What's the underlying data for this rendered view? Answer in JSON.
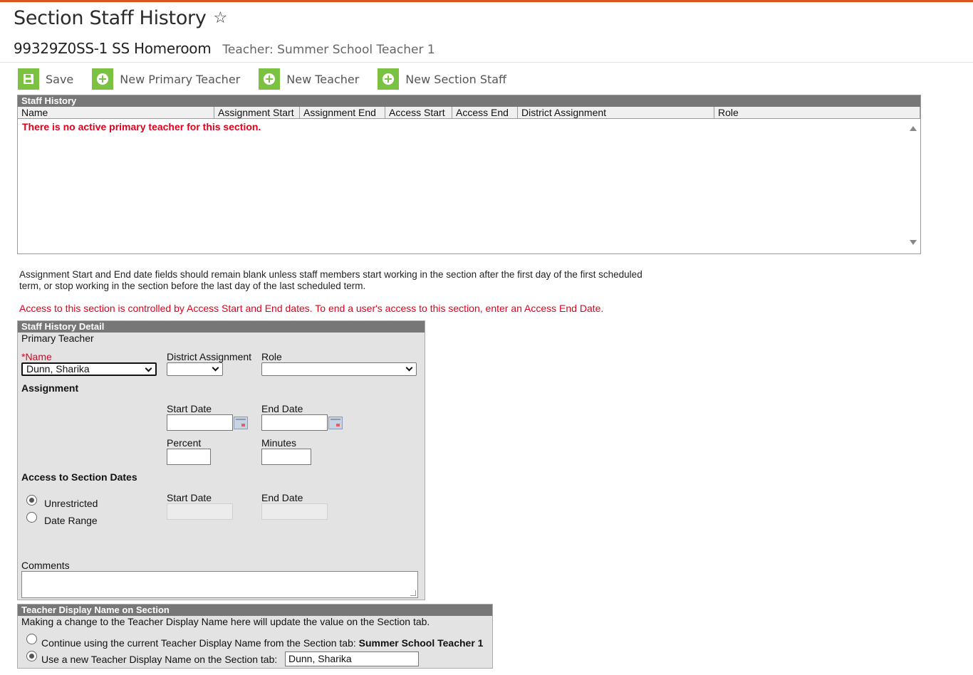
{
  "header": {
    "title": "Section Staff History",
    "favorite_icon": "star-outline-icon",
    "section_name": "99329Z0SS-1 SS Homeroom",
    "teacher_label": "Teacher: Summer School Teacher 1"
  },
  "toolbar": {
    "save_label": "Save",
    "new_primary_teacher_label": "New Primary Teacher",
    "new_teacher_label": "New Teacher",
    "new_section_staff_label": "New Section Staff",
    "accent_color": "#7cc242"
  },
  "history": {
    "title": "Staff History",
    "columns": [
      "Name",
      "Assignment Start",
      "Assignment End",
      "Access Start",
      "Access End",
      "District Assignment",
      "Role"
    ],
    "empty_message": "There is no active primary teacher for this section."
  },
  "notes": {
    "assignment_note": "Assignment Start and End date fields should remain blank unless staff members start working in the section after the first day of the first scheduled term, or stop working in the section before the last day of the last scheduled term.",
    "access_warning": "Access to this section is controlled by Access Start and End dates. To end a user's access to this section, enter an Access End Date."
  },
  "detail": {
    "title": "Staff History Detail",
    "subtitle": "Primary Teacher",
    "name_label": "*Name",
    "name_value": "Dunn, Sharika",
    "district_assignment_label": "District Assignment",
    "district_assignment_value": "",
    "role_label": "Role",
    "role_value": "",
    "assignment_heading": "Assignment",
    "start_date_label": "Start Date",
    "end_date_label": "End Date",
    "percent_label": "Percent",
    "minutes_label": "Minutes",
    "access_heading": "Access to Section Dates",
    "unrestricted_label": "Unrestricted",
    "date_range_label": "Date Range",
    "access_start_label": "Start Date",
    "access_end_label": "End Date",
    "access_mode": "Unrestricted",
    "comments_label": "Comments"
  },
  "display_name": {
    "title": "Teacher Display Name on Section",
    "description": "Making a change to the Teacher Display Name here will update the value on the Section tab.",
    "option_continue_label": "Continue using the current Teacher Display Name from the Section tab:",
    "option_continue_value": "Summer School Teacher 1",
    "option_new_label": "Use a new Teacher Display Name on the Section tab:",
    "option_new_value": "Dunn, Sharika",
    "selected": "new"
  },
  "colors": {
    "error_red": "#e0001b",
    "panel_header": "#777777",
    "panel_bg": "#e3e3e3"
  }
}
